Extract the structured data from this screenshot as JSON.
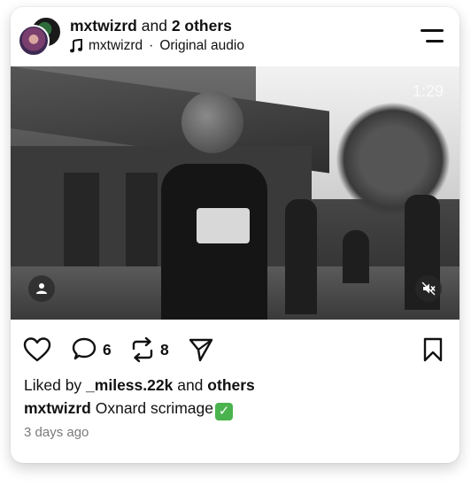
{
  "header": {
    "author": "mxtwizrd",
    "connector": "and",
    "others": "2 others",
    "audio_author": "mxtwizrd",
    "audio_separator": "·",
    "audio_title": "Original audio",
    "menu_icon": "menu-icon"
  },
  "media": {
    "timer": "1:29",
    "user_icon": "user-icon",
    "mute_icon": "muted-speaker-icon"
  },
  "actions": {
    "like_icon": "heart-icon",
    "comment_icon": "comment-bubble-icon",
    "comment_count": "6",
    "repost_icon": "repost-icon",
    "repost_count": "8",
    "share_icon": "send-icon",
    "save_icon": "bookmark-icon"
  },
  "likes": {
    "prefix": "Liked by",
    "user": "_miless.22k",
    "connector": "and",
    "others": "others"
  },
  "caption": {
    "author": "mxtwizrd",
    "text": "Oxnard scrimage",
    "emoji": "✓"
  },
  "timestamp": "3 days ago",
  "colors": {
    "text": "#111111",
    "muted": "#7a7a7a",
    "check_green": "#4ab34e"
  }
}
